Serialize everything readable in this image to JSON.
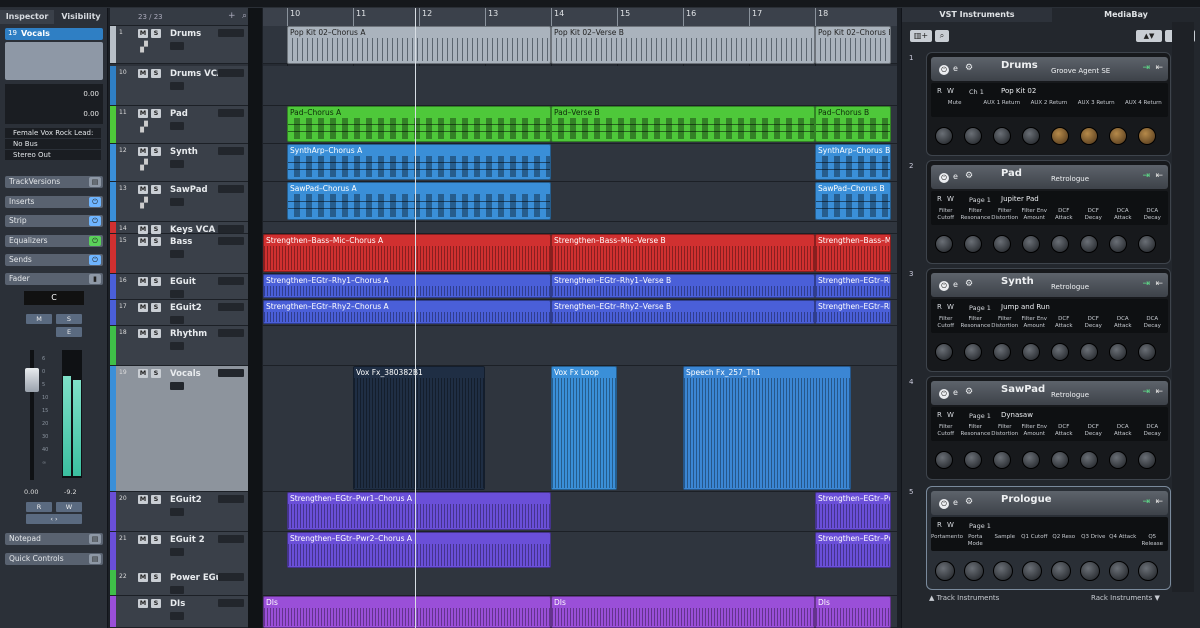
{
  "inspector": {
    "tabs": [
      "Inspector",
      "Visibility"
    ],
    "track_number": "19",
    "track_name": "Vocals",
    "volume": "0.00",
    "pan": "0.00",
    "input": "Female Vox Rock Lead:",
    "output_bus": "No Bus",
    "stereo": "Stereo Out",
    "sections": [
      "TrackVersions",
      "Inserts",
      "Strip",
      "Equalizers",
      "Sends",
      "Fader"
    ],
    "pan_value": "C",
    "fader_left": "0.00",
    "fader_right": "-9.2",
    "meter_scale": [
      "6",
      "0",
      "5",
      "10",
      "15",
      "20",
      "30",
      "40",
      "∞"
    ],
    "btn_m": "M",
    "btn_s": "S",
    "btn_e": "E",
    "btn_r": "R",
    "btn_w": "W",
    "notepad": "Notepad",
    "quick_controls": "Quick Controls"
  },
  "tracklist": {
    "counter": "23 / 23",
    "tracks": [
      {
        "num": "1",
        "name": "Drums",
        "color": "#b8c0c8"
      },
      {
        "num": "10",
        "name": "Drums VCA",
        "color": "#2f7fc4"
      },
      {
        "num": "11",
        "name": "Pad",
        "color": "#4ec83a"
      },
      {
        "num": "12",
        "name": "Synth",
        "color": "#3a8fd8"
      },
      {
        "num": "13",
        "name": "SawPad",
        "color": "#3a8fd8"
      },
      {
        "num": "14",
        "name": "Keys VCA",
        "color": "#d03030"
      },
      {
        "num": "15",
        "name": "Bass",
        "color": "#d03030"
      },
      {
        "num": "16",
        "name": "EGuit",
        "color": "#4a5fd8"
      },
      {
        "num": "17",
        "name": "EGuit2",
        "color": "#4a5fd8"
      },
      {
        "num": "18",
        "name": "Rhythm",
        "color": "#3fbf48"
      },
      {
        "num": "19",
        "name": "Vocals",
        "color": "#3a8fd8"
      },
      {
        "num": "20",
        "name": "EGuit2",
        "color": "#6a4fd8"
      },
      {
        "num": "21",
        "name": "EGuit 2",
        "color": "#6a4fd8"
      },
      {
        "num": "22",
        "name": "Power EGuit",
        "color": "#3fbf48"
      },
      {
        "num": "",
        "name": "DIs",
        "color": "#9a4fd8"
      }
    ]
  },
  "ruler": [
    "10",
    "11",
    "12",
    "13",
    "14",
    "15",
    "16",
    "17",
    "18"
  ],
  "clips": {
    "drums_a": "Pop Kit 02–Chorus A",
    "drums_b": "Pop Kit 02–Verse B",
    "drums_c": "Pop Kit 02–Chorus B",
    "pad_a": "Pad–Chorus A",
    "pad_b": "Pad–Verse B",
    "pad_c": "Pad–Chorus B",
    "synth_a": "SynthArp–Chorus A",
    "synth_c": "SynthArp–Chorus B",
    "sawpad_a": "SawPad–Chorus A",
    "sawpad_c": "SawPad–Chorus B",
    "bass_a": "Strengthen–Bass–Mic–Chorus A",
    "bass_b": "Strengthen–Bass–Mic–Verse B",
    "bass_c": "Strengthen–Bass–Mi",
    "egt1_a": "Strengthen–EGtr–Rhy1–Chorus A",
    "egt1_b": "Strengthen–EGtr–Rhy1–Verse B",
    "egt1_c": "Strengthen–EGtr–Rh",
    "egt2_a": "Strengthen–EGtr–Rhy2–Chorus A",
    "egt2_b": "Strengthen–EGtr–Rhy2–Verse B",
    "egt2_c": "Strengthen–EGtr–Rh",
    "vox1": "Vox Fx_380382B1",
    "vox2": "Vox Fx Loop",
    "vox3": "Speech Fx_257_Th1",
    "pwr1_a": "Strengthen–EGtr–Pwr1–Chorus A",
    "pwr1_c": "Strengthen–EGtr–Pw",
    "pwr2_a": "Strengthen–EGtr–Pwr2–Chorus A",
    "pwr2_c": "Strengthen–EGtr–Pw",
    "dis": "DIs"
  },
  "vst": {
    "tabs": [
      "VST Instruments",
      "MediaBay"
    ],
    "slots": [
      {
        "num": "1",
        "name": "Drums",
        "plugin": "Groove Agent SE",
        "preset": "Pop Kit 02",
        "ch": "Ch 1",
        "labels": [
          "Mute",
          "AUX 1 Return",
          "AUX 2 Return",
          "AUX 3 Return",
          "AUX 4 Return"
        ]
      },
      {
        "num": "2",
        "name": "Pad",
        "plugin": "Retrologue",
        "preset": "Jupiter Pad",
        "page": "Page 1",
        "labels": [
          "Filter Cutoff",
          "Filter Resonance",
          "Filter Distortion",
          "Filter Env Amount",
          "DCF Attack",
          "DCF Decay",
          "DCA Attack",
          "DCA Decay"
        ]
      },
      {
        "num": "3",
        "name": "Synth",
        "plugin": "Retrologue",
        "preset": "Jump and Run",
        "page": "Page 1",
        "labels": [
          "Filter Cutoff",
          "Filter Resonance",
          "Filter Distortion",
          "Filter Env Amount",
          "DCF Attack",
          "DCF Decay",
          "DCA Attack",
          "DCA Decay"
        ]
      },
      {
        "num": "4",
        "name": "SawPad",
        "plugin": "Retrologue",
        "preset": "Dynasaw",
        "page": "Page 1",
        "labels": [
          "Filter Cutoff",
          "Filter Resonance",
          "Filter Distortion",
          "Filter Env Amount",
          "DCF Attack",
          "DCF Decay",
          "DCA Attack",
          "DCA Decay"
        ]
      },
      {
        "num": "5",
        "name": "Prologue",
        "plugin": "",
        "preset": "",
        "page": "Page 1",
        "labels": [
          "Portamento",
          "Porta Mode",
          "Sample",
          "Q1 Cutoff",
          "Q2 Reso",
          "Q3 Drive",
          "Q4 Attack",
          "Q5 Release"
        ]
      }
    ],
    "rw": [
      "R",
      "W"
    ],
    "footer_left": "▲ Track Instruments",
    "footer_right": "Rack Instruments ▼"
  },
  "colors": {
    "pad": "#4ec83a",
    "synth": "#3a8fd8",
    "bass": "#d03030",
    "egt": "#4a5fd8",
    "pwr": "#6a4fd8",
    "dis": "#9a4fd8",
    "drums": "#aab3bd"
  }
}
